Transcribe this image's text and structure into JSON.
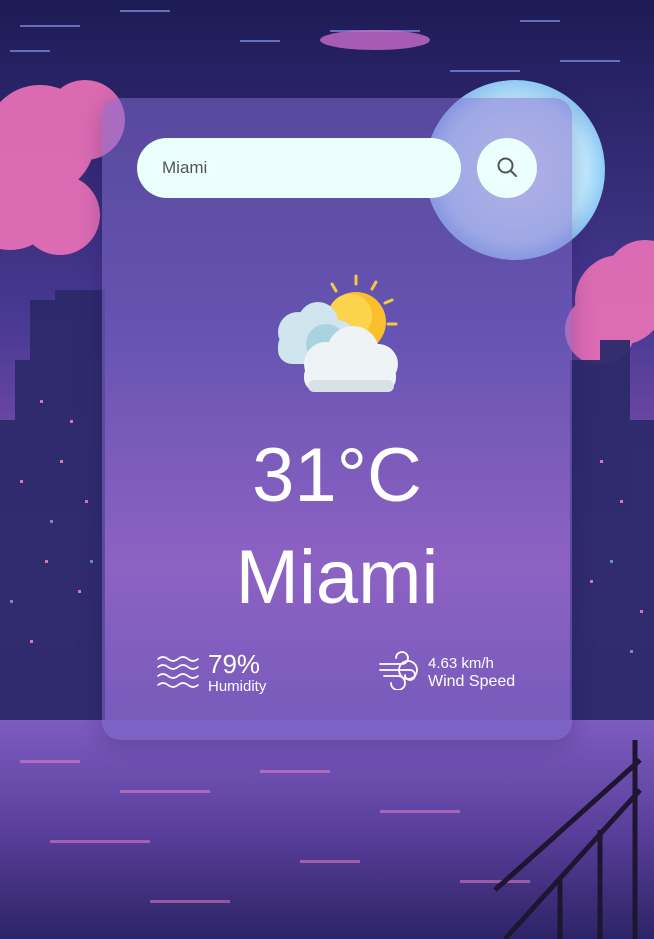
{
  "search": {
    "value": "Miami",
    "placeholder": ""
  },
  "weather": {
    "icon": "partly-cloudy-sun-icon",
    "temperature": "31°C",
    "city": "Miami",
    "humidity": {
      "value": "79%",
      "label": "Humidity",
      "icon": "humidity-waves-icon"
    },
    "wind": {
      "value": "4.63 km/h",
      "label": "Wind Speed",
      "icon": "wind-icon"
    }
  },
  "colors": {
    "card": "#806ccd",
    "input_bg": "#ebfffc",
    "text": "#ffffff",
    "sun": "#fbbf2e",
    "cloud": "#eef3f6"
  }
}
